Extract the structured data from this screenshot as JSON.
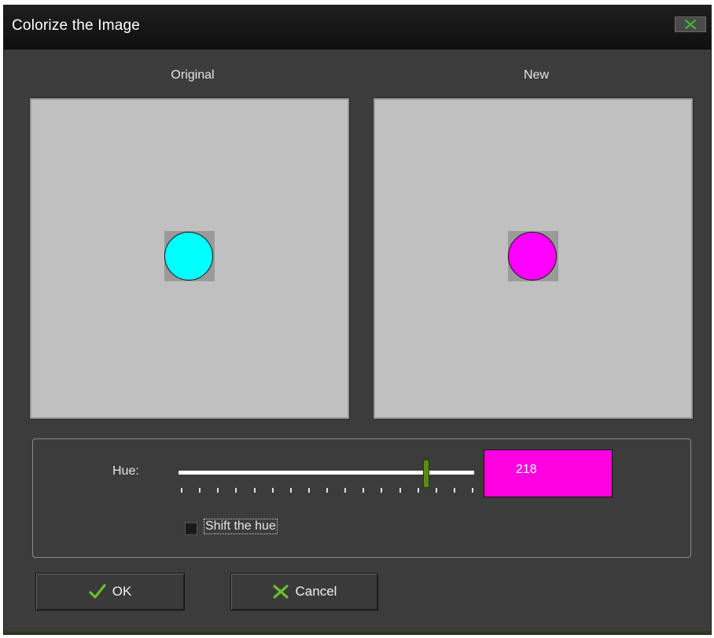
{
  "dialog": {
    "title": "Colorize the Image",
    "close_icon": "close-x-icon"
  },
  "preview": {
    "original_label": "Original",
    "new_label": "New",
    "original_color": "#00ffff",
    "new_color": "#ff00ff",
    "backdrop_color": "#c0c0c0"
  },
  "hue": {
    "label": "Hue:",
    "value": "218",
    "slider_fraction": 0.838,
    "swatch_color": "#ff00e0",
    "tick_count": 17
  },
  "shift": {
    "label": "Shift the hue",
    "checked": false
  },
  "buttons": {
    "ok_label": "OK",
    "ok_icon": "checkmark-icon",
    "cancel_label": "Cancel",
    "cancel_icon": "x-cancel-icon"
  },
  "colors": {
    "accent_green": "#5c8a1a",
    "window_bg": "#3c3c3c"
  }
}
